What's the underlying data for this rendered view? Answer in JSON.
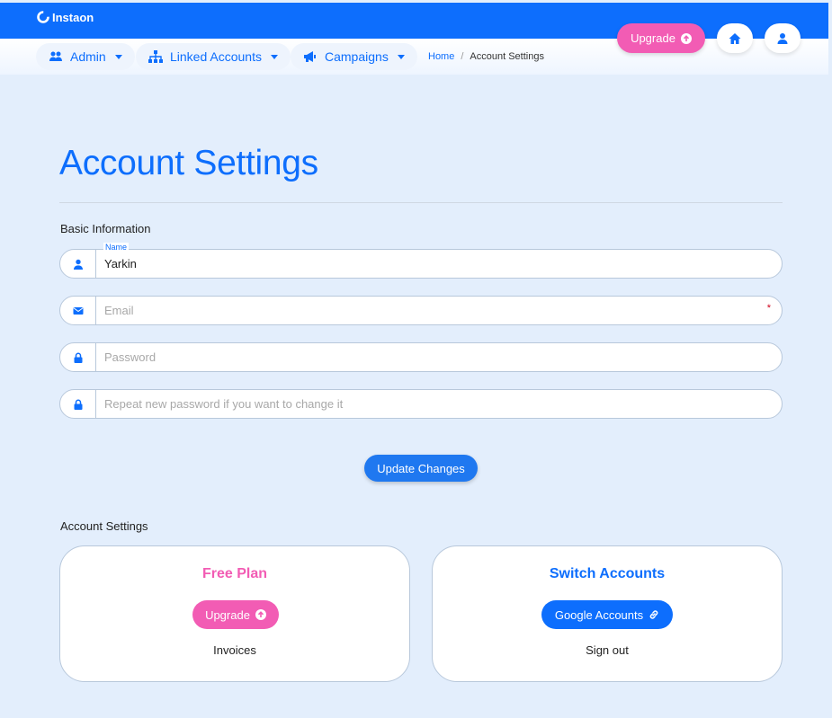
{
  "app": {
    "name": "Instaon"
  },
  "nav": {
    "items": [
      {
        "label": "Admin",
        "icon": "users-icon"
      },
      {
        "label": "Linked Accounts",
        "icon": "sitemap-icon"
      },
      {
        "label": "Campaigns",
        "icon": "megaphone-icon"
      }
    ]
  },
  "breadcrumb": {
    "home": "Home",
    "separator": "/",
    "current": "Account Settings"
  },
  "header": {
    "upgrade_label": "Upgrade"
  },
  "page": {
    "title": "Account Settings",
    "basic_info_label": "Basic Information",
    "name_label": "Name",
    "name_value": "Yarkin",
    "email_placeholder": "Email",
    "email_required_mark": "*",
    "password_placeholder": "Password",
    "repeat_password_placeholder": "Repeat new password if you want to change it",
    "update_button": "Update Changes",
    "account_settings_label": "Account Settings"
  },
  "plan_card": {
    "title": "Free Plan",
    "button": "Upgrade",
    "link": "Invoices"
  },
  "switch_card": {
    "title": "Switch Accounts",
    "button": "Google Accounts",
    "link": "Sign out"
  },
  "colors": {
    "primary": "#0d6efd",
    "accent_pink": "#f25cb4",
    "background": "#e3eefc"
  }
}
